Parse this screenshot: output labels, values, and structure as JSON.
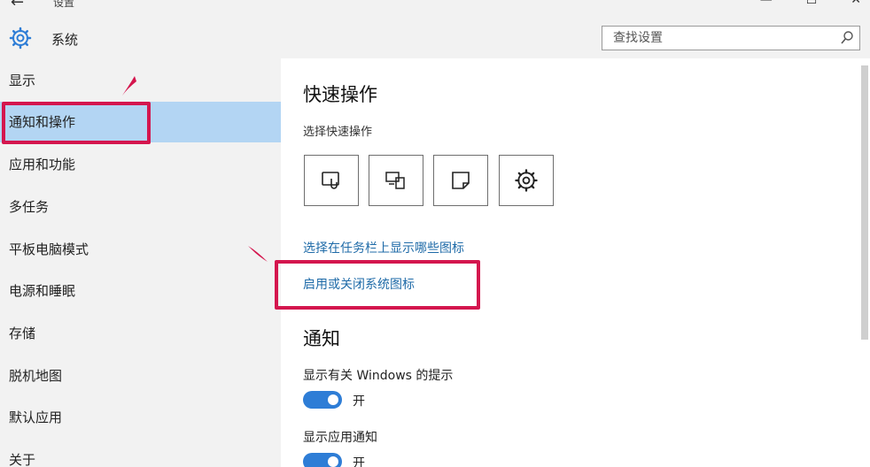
{
  "titlebar": {
    "app_title": "设置",
    "section_title": "系统",
    "search_placeholder": "查找设置",
    "controls": [
      "—",
      "☐",
      "✕"
    ]
  },
  "sidebar": {
    "items": [
      {
        "label": "显示"
      },
      {
        "label": "通知和操作",
        "active": true
      },
      {
        "label": "应用和功能"
      },
      {
        "label": "多任务"
      },
      {
        "label": "平板电脑模式"
      },
      {
        "label": "电源和睡眠"
      },
      {
        "label": "存储"
      },
      {
        "label": "脱机地图"
      },
      {
        "label": "默认应用"
      },
      {
        "label": "关于"
      }
    ]
  },
  "main": {
    "quick_actions_heading": "快速操作",
    "quick_actions_sub": "选择快速操作",
    "quick_action_tiles": [
      "tablet-mode-icon",
      "project-icon",
      "note-icon",
      "settings-icon"
    ],
    "link_taskbar_icons": "选择在任务栏上显示哪些图标",
    "link_system_icons": "启用或关闭系统图标",
    "notifications_heading": "通知",
    "opt_windows_tips": "显示有关 Windows 的提示",
    "opt_windows_tips_state": "开",
    "opt_app_notifications": "显示应用通知",
    "opt_app_notifications_state": "开"
  },
  "colors": {
    "accent": "#2e7dd6",
    "active_nav": "#b3d5f3",
    "annotation": "#d4164e",
    "link": "#1f6ba8"
  }
}
